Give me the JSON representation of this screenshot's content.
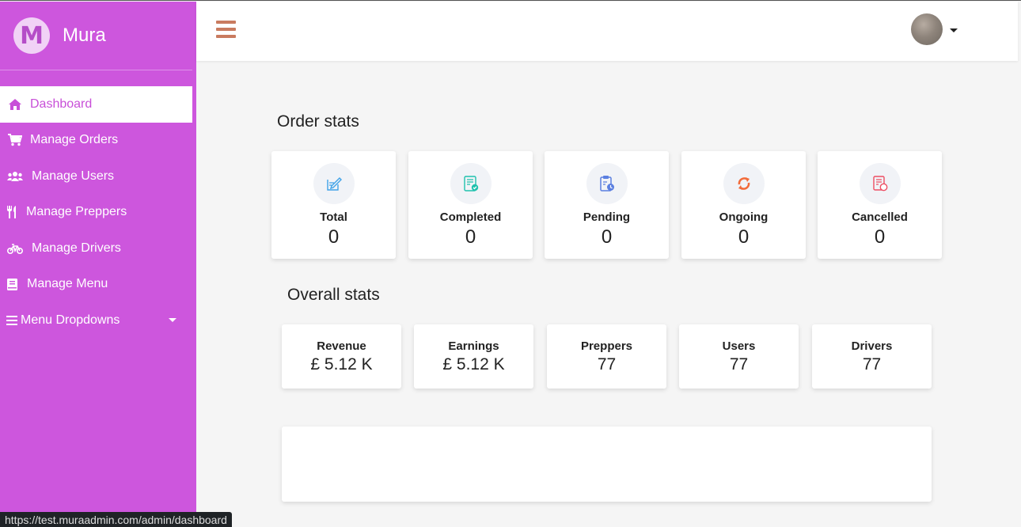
{
  "brand": {
    "logo_letter": "M",
    "name": "Mura"
  },
  "sidebar": {
    "items": [
      {
        "label": "Dashboard",
        "icon": "home-icon",
        "active": true
      },
      {
        "label": "Manage Orders",
        "icon": "cart-icon"
      },
      {
        "label": "Manage Users",
        "icon": "users-icon"
      },
      {
        "label": "Manage Preppers",
        "icon": "utensils-icon"
      },
      {
        "label": "Manage Drivers",
        "icon": "bicycle-icon"
      },
      {
        "label": "Manage Menu",
        "icon": "book-icon"
      },
      {
        "label": "Menu Dropdowns",
        "icon": "bars-icon"
      }
    ]
  },
  "header": {
    "menu_icon": "hamburger-icon",
    "avatar_icon": "user-avatar"
  },
  "order_stats": {
    "title": "Order stats",
    "cards": [
      {
        "label": "Total",
        "value": "0",
        "icon": "edit-icon",
        "color": "#3fa2e8"
      },
      {
        "label": "Completed",
        "value": "0",
        "icon": "completed-doc-icon",
        "color": "#1fc1ad"
      },
      {
        "label": "Pending",
        "value": "0",
        "icon": "clipboard-clock-icon",
        "color": "#5b7fe0"
      },
      {
        "label": "Ongoing",
        "value": "0",
        "icon": "refresh-icon",
        "color": "#f26b3a"
      },
      {
        "label": "Cancelled",
        "value": "0",
        "icon": "cancelled-doc-icon",
        "color": "#ee4e63"
      }
    ]
  },
  "overall_stats": {
    "title": "Overall stats",
    "cards": [
      {
        "label": "Revenue",
        "value": "£ 5.12 K"
      },
      {
        "label": "Earnings",
        "value": "£ 5.12 K"
      },
      {
        "label": "Preppers",
        "value": "77"
      },
      {
        "label": "Users",
        "value": "77"
      },
      {
        "label": "Drivers",
        "value": "77"
      }
    ]
  },
  "status_bar": {
    "url": "https://test.muraadmin.com/admin/dashboard"
  },
  "colors": {
    "sidebar": "#cd56dd",
    "accent": "#c84fd8",
    "hamburger": "#c97b5f"
  }
}
